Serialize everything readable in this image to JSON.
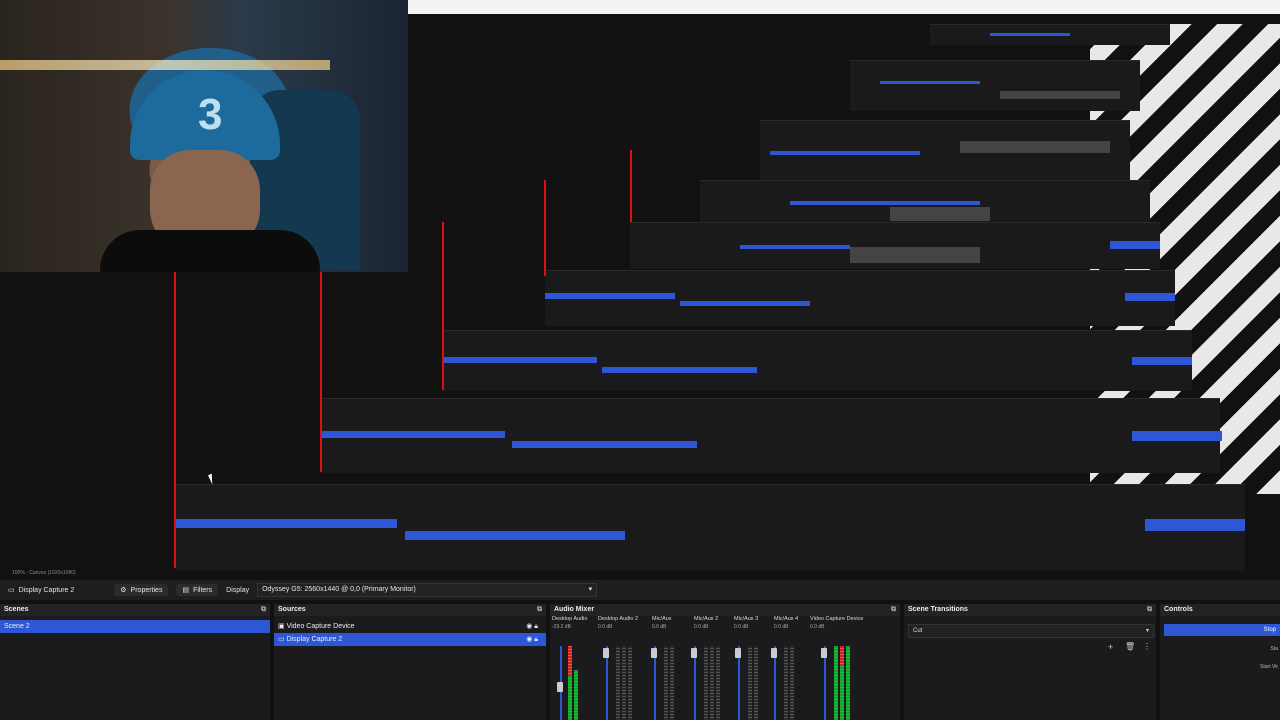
{
  "toolbar": {
    "source_name": "Display Capture 2",
    "properties_label": "Properties",
    "filters_label": "Filters",
    "display_label": "Display",
    "display_value": "Odyssey G5: 2560x1440 @ 0,0 (Primary Monitor)"
  },
  "status": {
    "zoom": "100%",
    "canvas": "Canvas (1920x1080)"
  },
  "scenes": {
    "title": "Scenes",
    "items": [
      "Scene 2"
    ]
  },
  "sources": {
    "title": "Sources",
    "items": [
      "Video Capture Device",
      "Display Capture 2"
    ]
  },
  "audio_mixer": {
    "title": "Audio Mixer",
    "channels": [
      {
        "name": "Desktop Audio",
        "db": "-29.2 dB"
      },
      {
        "name": "Desktop Audio 2",
        "db": "0.0 dB"
      },
      {
        "name": "Mic/Aux",
        "db": "0.0 dB"
      },
      {
        "name": "Mic/Aux 2",
        "db": "0.0 dB"
      },
      {
        "name": "Mic/Aux 3",
        "db": "0.0 dB"
      },
      {
        "name": "Mic/Aux 4",
        "db": "0.0 dB"
      },
      {
        "name": "Video Capture Device",
        "db": "0.0 dB"
      }
    ]
  },
  "scene_transitions": {
    "title": "Scene Transitions",
    "value": "Cut"
  },
  "controls": {
    "title": "Controls",
    "primary": "Stop",
    "items": [
      "Sta",
      "Start Vir"
    ]
  },
  "icons": {
    "add": "plus-icon",
    "remove": "trash-icon",
    "menu": "kebab-icon",
    "visibility": "eye-icon",
    "lock": "lock-icon"
  }
}
